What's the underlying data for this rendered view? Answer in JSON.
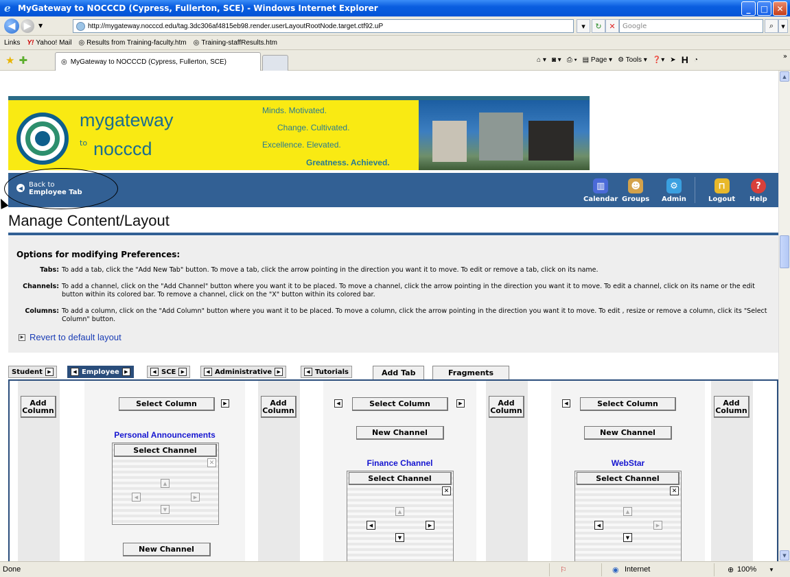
{
  "window": {
    "title": "MyGateway to NOCCCD (Cypress, Fullerton, SCE) - Windows Internet Explorer"
  },
  "address": {
    "url": "http://mygateway.nocccd.edu/tag.3dc306af4815eb98.render.userLayoutRootNode.target.ctf92.uP",
    "search_placeholder": "Google"
  },
  "links_bar": {
    "label": "Links",
    "items": [
      "Yahoo! Mail",
      "Results from Training-faculty.htm",
      "Training-staffResults.htm"
    ]
  },
  "browser_tab": {
    "label": "MyGateway to NOCCCD (Cypress, Fullerton, SCE)"
  },
  "commands": {
    "page": "Page",
    "tools": "Tools"
  },
  "banner": {
    "brand_top": "mygateway",
    "brand_to": "to",
    "brand_bottom": "nocccd",
    "slogans": [
      "Minds. Motivated.",
      "Change. Cultivated.",
      "Excellence. Elevated.",
      "Greatness. Achieved."
    ]
  },
  "nav": {
    "back_line1": "Back to",
    "back_line2": "Employee Tab",
    "icons": [
      "Calendar",
      "Groups",
      "Admin",
      "Logout",
      "Help"
    ]
  },
  "page": {
    "title": "Manage Content/Layout",
    "options_heading": "Options for modifying Preferences:",
    "options": [
      {
        "label": "Tabs:",
        "text": "To add a tab, click the \"Add New Tab\" button. To move a tab, click the arrow pointing in the direction you want it to move. To edit or remove a tab, click on its name."
      },
      {
        "label": "Channels:",
        "text": "To add a channel, click on the \"Add Channel\" button where you want it to be placed. To move a channel, click the arrow pointing in the direction you want it to move. To edit a channel, click on its name or the edit button within its colored bar. To remove a channel, click on the \"X\" button within its colored bar."
      },
      {
        "label": "Columns:",
        "text": "To add a column, click on the \"Add Column\" button where you want it to be placed. To move a column, click the arrow pointing in the direction you want it to move. To edit , resize or remove a column, click its \"Select Column\" button."
      }
    ],
    "revert": "Revert to default layout"
  },
  "tabs": [
    "Student",
    "Employee",
    "SCE",
    "Administrative",
    "Tutorials",
    "Add Tab",
    "Fragments"
  ],
  "layout": {
    "add_column": "Add Column",
    "select_column": "Select Column",
    "select_channel": "Select Channel",
    "new_channel": "New Channel",
    "channels": [
      "Personal Announcements",
      "Finance Channel",
      "WebStar"
    ]
  },
  "status": {
    "text": "Done",
    "zone": "Internet",
    "zoom": "100%"
  }
}
